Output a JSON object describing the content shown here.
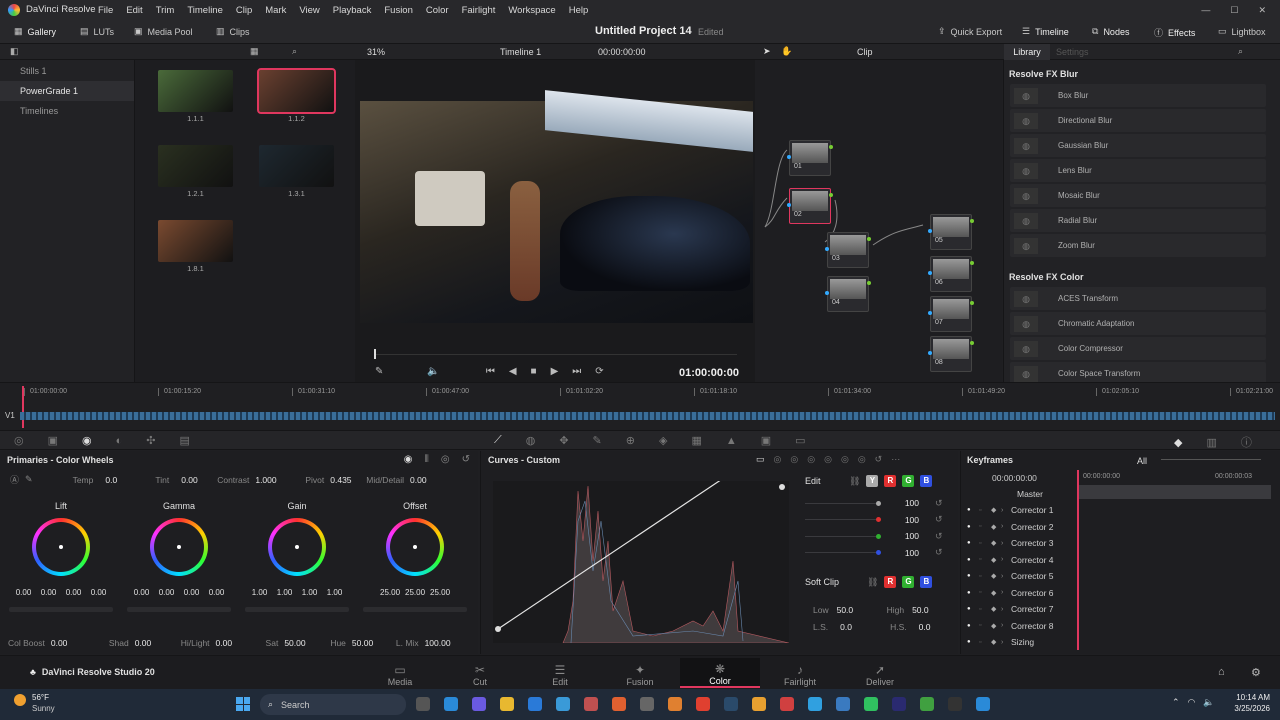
{
  "app": {
    "name": "DaVinci Resolve",
    "menu": [
      "File",
      "Edit",
      "Trim",
      "Timeline",
      "Clip",
      "Mark",
      "View",
      "Playback",
      "Fusion",
      "Color",
      "Fairlight",
      "Workspace",
      "Help"
    ]
  },
  "toolbar": {
    "gallery": "Gallery",
    "luts": "LUTs",
    "media_pool": "Media Pool",
    "clips": "Clips",
    "project_title": "Untitled Project 14",
    "project_status": "Edited",
    "quick_export": "Quick Export",
    "timeline": "Timeline",
    "nodes": "Nodes",
    "effects": "Effects",
    "lightbox": "Lightbox"
  },
  "viewer_bar": {
    "zoom": "31%",
    "timeline_name": "Timeline 1",
    "timecode": "00:00:00:00",
    "clip_mode": "Clip"
  },
  "library_tabs": {
    "library": "Library",
    "settings": "Settings"
  },
  "sidebar": {
    "items": [
      "Stills 1",
      "PowerGrade 1",
      "Timelines"
    ]
  },
  "stills": [
    {
      "label": "1.1.1",
      "color": "#4a6a3a"
    },
    {
      "label": "1.1.2",
      "color": "#6a4030"
    },
    {
      "label": "1.2.1",
      "color": "#2a3020"
    },
    {
      "label": "1.3.1",
      "color": "#1e2830"
    },
    {
      "label": "1.8.1",
      "color": "#7a4a30"
    }
  ],
  "viewer": {
    "timecode": "01:00:00:00"
  },
  "nodes": [
    {
      "label": "01"
    },
    {
      "label": "02"
    },
    {
      "label": "03"
    },
    {
      "label": "04"
    },
    {
      "label": "05"
    },
    {
      "label": "06"
    },
    {
      "label": "07"
    },
    {
      "label": "08"
    }
  ],
  "library": {
    "sections": [
      {
        "title": "Resolve FX Blur",
        "items": [
          "Box Blur",
          "Directional Blur",
          "Gaussian Blur",
          "Lens Blur",
          "Mosaic Blur",
          "Radial Blur",
          "Zoom Blur"
        ]
      },
      {
        "title": "Resolve FX Color",
        "items": [
          "ACES Transform",
          "Chromatic Adaptation",
          "Color Compressor",
          "Color Space Transform"
        ]
      }
    ]
  },
  "timeline": {
    "track": "V1",
    "ticks": [
      "01:00:00:00",
      "01:00:15:20",
      "01:00:31:10",
      "01:00:47:00",
      "01:01:02:20",
      "01:01:18:10",
      "01:01:34:00",
      "01:01:49:20",
      "01:02:05:10",
      "01:02:21:00"
    ]
  },
  "primaries": {
    "title": "Primaries - Color Wheels",
    "temp_label": "Temp",
    "temp": "0.0",
    "tint_label": "Tint",
    "tint": "0.00",
    "contrast_label": "Contrast",
    "contrast": "1.000",
    "pivot_label": "Pivot",
    "pivot": "0.435",
    "md_label": "Mid/Detail",
    "md": "0.00",
    "wheels": [
      {
        "name": "Lift",
        "values": [
          "0.00",
          "0.00",
          "0.00",
          "0.00"
        ]
      },
      {
        "name": "Gamma",
        "values": [
          "0.00",
          "0.00",
          "0.00",
          "0.00"
        ]
      },
      {
        "name": "Gain",
        "values": [
          "1.00",
          "1.00",
          "1.00",
          "1.00"
        ]
      },
      {
        "name": "Offset",
        "values": [
          "25.00",
          "25.00",
          "25.00"
        ]
      }
    ],
    "colboost_label": "Col Boost",
    "colboost": "0.00",
    "shad_label": "Shad",
    "shad": "0.00",
    "hilight_label": "Hi/Light",
    "hilight": "0.00",
    "sat_label": "Sat",
    "sat": "50.00",
    "hue_label": "Hue",
    "hue": "50.00",
    "lmix_label": "L. Mix",
    "lmix": "100.00"
  },
  "curves": {
    "title": "Curves - Custom",
    "edit_label": "Edit",
    "channels": [
      "Y",
      "R",
      "G",
      "B"
    ],
    "channel_colors": [
      "#aaaaaa",
      "#e03030",
      "#30b030",
      "#3050e0"
    ],
    "intensities": [
      "100",
      "100",
      "100",
      "100"
    ],
    "softclip_label": "Soft Clip",
    "low_label": "Low",
    "low": "50.0",
    "high_label": "High",
    "high": "50.0",
    "ls_label": "L.S.",
    "ls": "0.0",
    "hs_label": "H.S.",
    "hs": "0.0"
  },
  "keyframes": {
    "title": "Keyframes",
    "filter": "All",
    "time": "00:00:00:00",
    "time_a": "00:00:00:00",
    "time_b": "00:00:00:03",
    "rows": [
      "Master",
      "Corrector 1",
      "Corrector 2",
      "Corrector 3",
      "Corrector 4",
      "Corrector 5",
      "Corrector 6",
      "Corrector 7",
      "Corrector 8",
      "Sizing"
    ]
  },
  "pagebar": {
    "brand": "DaVinci Resolve Studio 20",
    "pages": [
      "Media",
      "Cut",
      "Edit",
      "Fusion",
      "Color",
      "Fairlight",
      "Deliver"
    ],
    "active": "Color"
  },
  "taskbar": {
    "weather_temp": "56°F",
    "weather_desc": "Sunny",
    "search": "Search",
    "time": "10:14 AM",
    "date": "3/25/2026"
  }
}
